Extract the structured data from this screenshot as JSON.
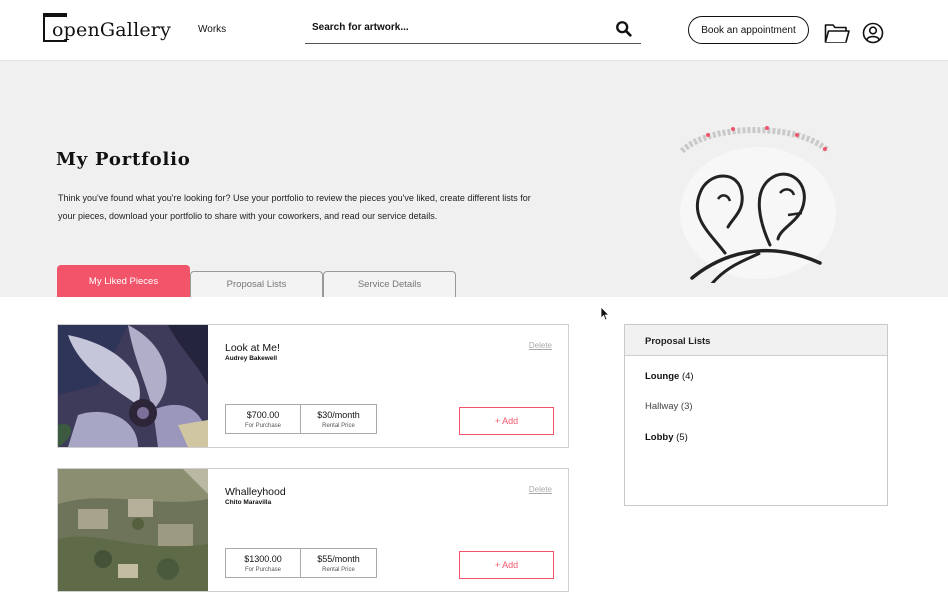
{
  "header": {
    "logo_text": "openGallery",
    "nav_works": "Works",
    "search_placeholder": "Search for artwork...",
    "book_button": "Book an appointment"
  },
  "hero": {
    "title": "My Portfolio",
    "description": "Think you've found what you're looking for? Use your portfolio to review the pieces you've liked, create different lists for your pieces, download your portfolio to share with your coworkers, and read our service details."
  },
  "tabs": [
    {
      "label": "My Liked Pieces",
      "active": true
    },
    {
      "label": "Proposal Lists",
      "active": false
    },
    {
      "label": "Service Details",
      "active": false
    }
  ],
  "cards": [
    {
      "title": "Look at Me!",
      "artist": "Audrey Bakewell",
      "delete": "Delete",
      "purchase_price": "$700.00",
      "purchase_label": "For Purchase",
      "rental_price": "$30/month",
      "rental_label": "Rental Price",
      "add_label": "+ Add"
    },
    {
      "title": "Whalleyhood",
      "artist": "Chito Maravilla",
      "delete": "Delete",
      "purchase_price": "$1300.00",
      "purchase_label": "For Purchase",
      "rental_price": "$55/month",
      "rental_label": "Rental Price",
      "add_label": "+ Add"
    }
  ],
  "proposal_panel": {
    "title": "Proposal Lists",
    "items": [
      {
        "name": "Lounge",
        "count": "(4)"
      },
      {
        "name": "Hallway",
        "count": "(3)"
      },
      {
        "name": "Lobby",
        "count": "(5)"
      }
    ]
  },
  "colors": {
    "accent": "#f2556a",
    "hero_bg": "#f0f0f0"
  }
}
